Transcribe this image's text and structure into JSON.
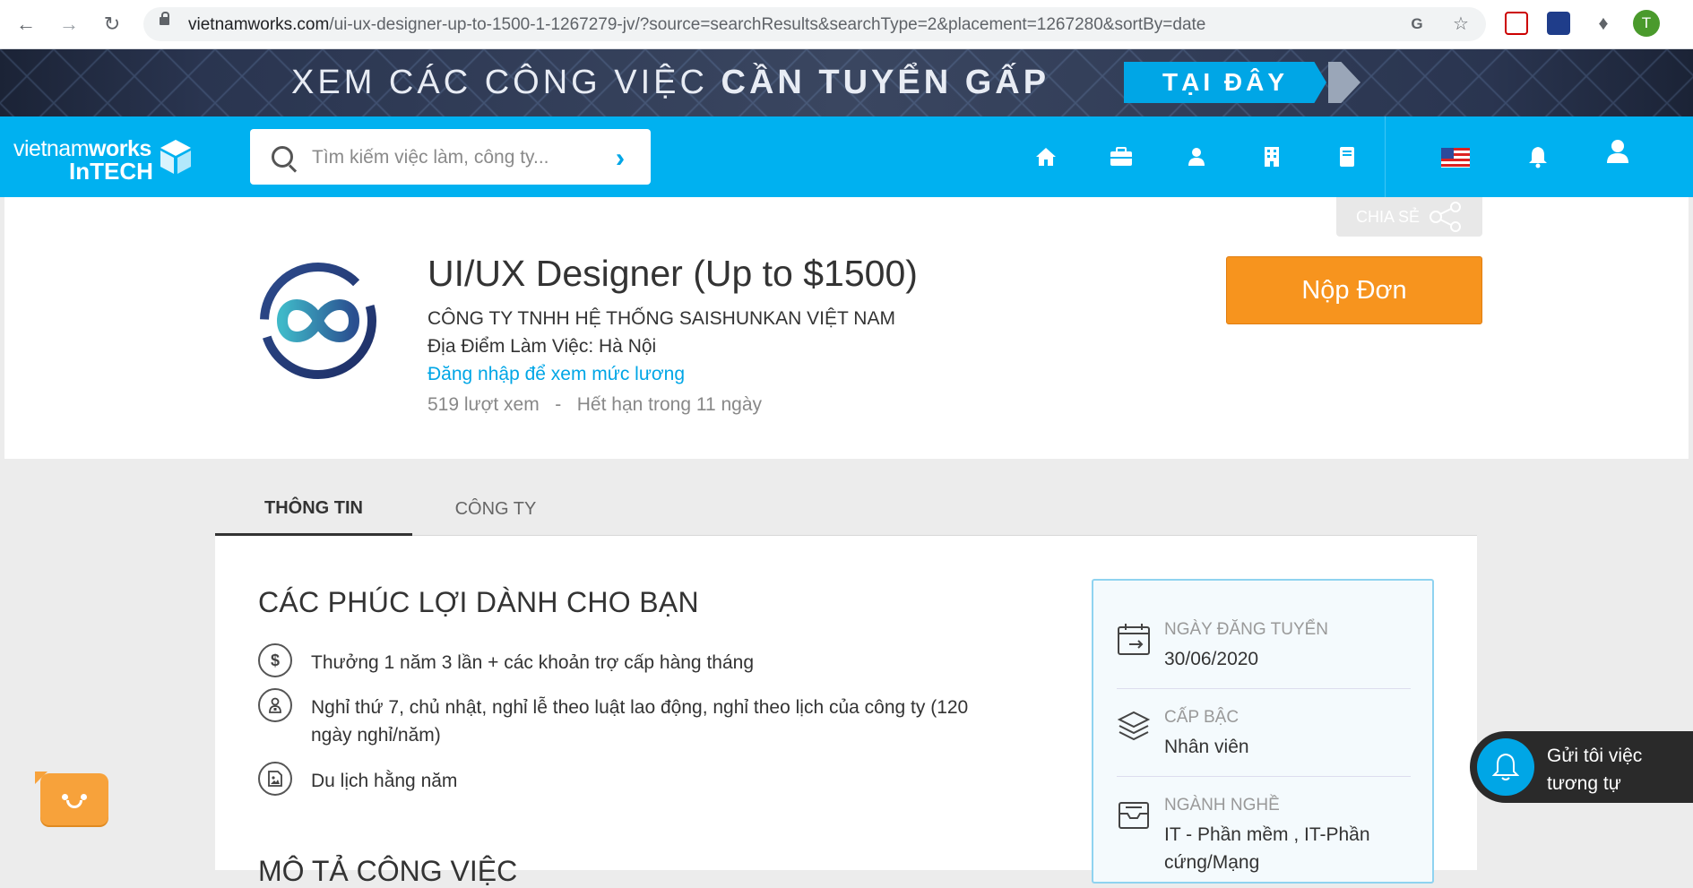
{
  "browser": {
    "url_host": "vietnamworks.com",
    "url_path": "/ui-ux-designer-up-to-1500-1-1267279-jv/?source=searchResults&searchType=2&placement=1267280&sortBy=date",
    "profile_initial": "T"
  },
  "banner": {
    "text_light": "XEM CÁC CÔNG VIỆC",
    "text_bold": "CẦN TUYỂN GẤP",
    "cta": "TẠI ĐÂY"
  },
  "header": {
    "logo_line1_light": "vietnam",
    "logo_line1_bold": "works",
    "logo_line2": "InTECH",
    "search_placeholder": "Tìm kiếm việc làm, công ty..."
  },
  "job": {
    "share_label": "CHIA SẺ",
    "title": "UI/UX Designer (Up to $1500)",
    "company": "CÔNG TY TNHH HỆ THỐNG SAISHUNKAN VIỆT NAM",
    "location": "Địa Điểm Làm Việc: Hà Nội",
    "salary_link": "Đăng nhập để xem mức lương",
    "views": "519 lượt xem",
    "separator": "-",
    "expiry": "Hết hạn trong 11 ngày",
    "apply_label": "Nộp Đơn"
  },
  "tabs": [
    {
      "label": "THÔNG TIN",
      "active": true
    },
    {
      "label": "CÔNG TY",
      "active": false
    }
  ],
  "benefits": {
    "title": "CÁC PHÚC LỢI DÀNH CHO BẠN",
    "items": [
      {
        "icon": "dollar-icon",
        "text": "Thưởng 1 năm 3 lần + các khoản trợ cấp hàng tháng"
      },
      {
        "icon": "doctor-icon",
        "text": "Nghỉ thứ 7, chủ nhật, nghỉ lễ theo luật lao động, nghỉ theo lịch của công ty (120 ngày nghỉ/năm)"
      },
      {
        "icon": "picture-icon",
        "text": "Du lịch hằng năm"
      }
    ]
  },
  "next_section_title": "MÔ TẢ CÔNG VIỆC",
  "summary": {
    "items": [
      {
        "icon": "calendar-icon",
        "label": "NGÀY ĐĂNG TUYỂN",
        "value": "30/06/2020"
      },
      {
        "icon": "layers-icon",
        "label": "CẤP BẬC",
        "value": "Nhân viên"
      },
      {
        "icon": "inbox-icon",
        "label": "NGÀNH NGHỀ",
        "value": "IT - Phần mềm ,  IT-Phần cứng/Mạng"
      }
    ]
  },
  "notify_widget": {
    "text": "Gửi tôi việc tương tự"
  },
  "colors": {
    "brand_blue": "#00b1f0",
    "apply_orange": "#f7941e",
    "link_blue": "#00a6e6"
  }
}
